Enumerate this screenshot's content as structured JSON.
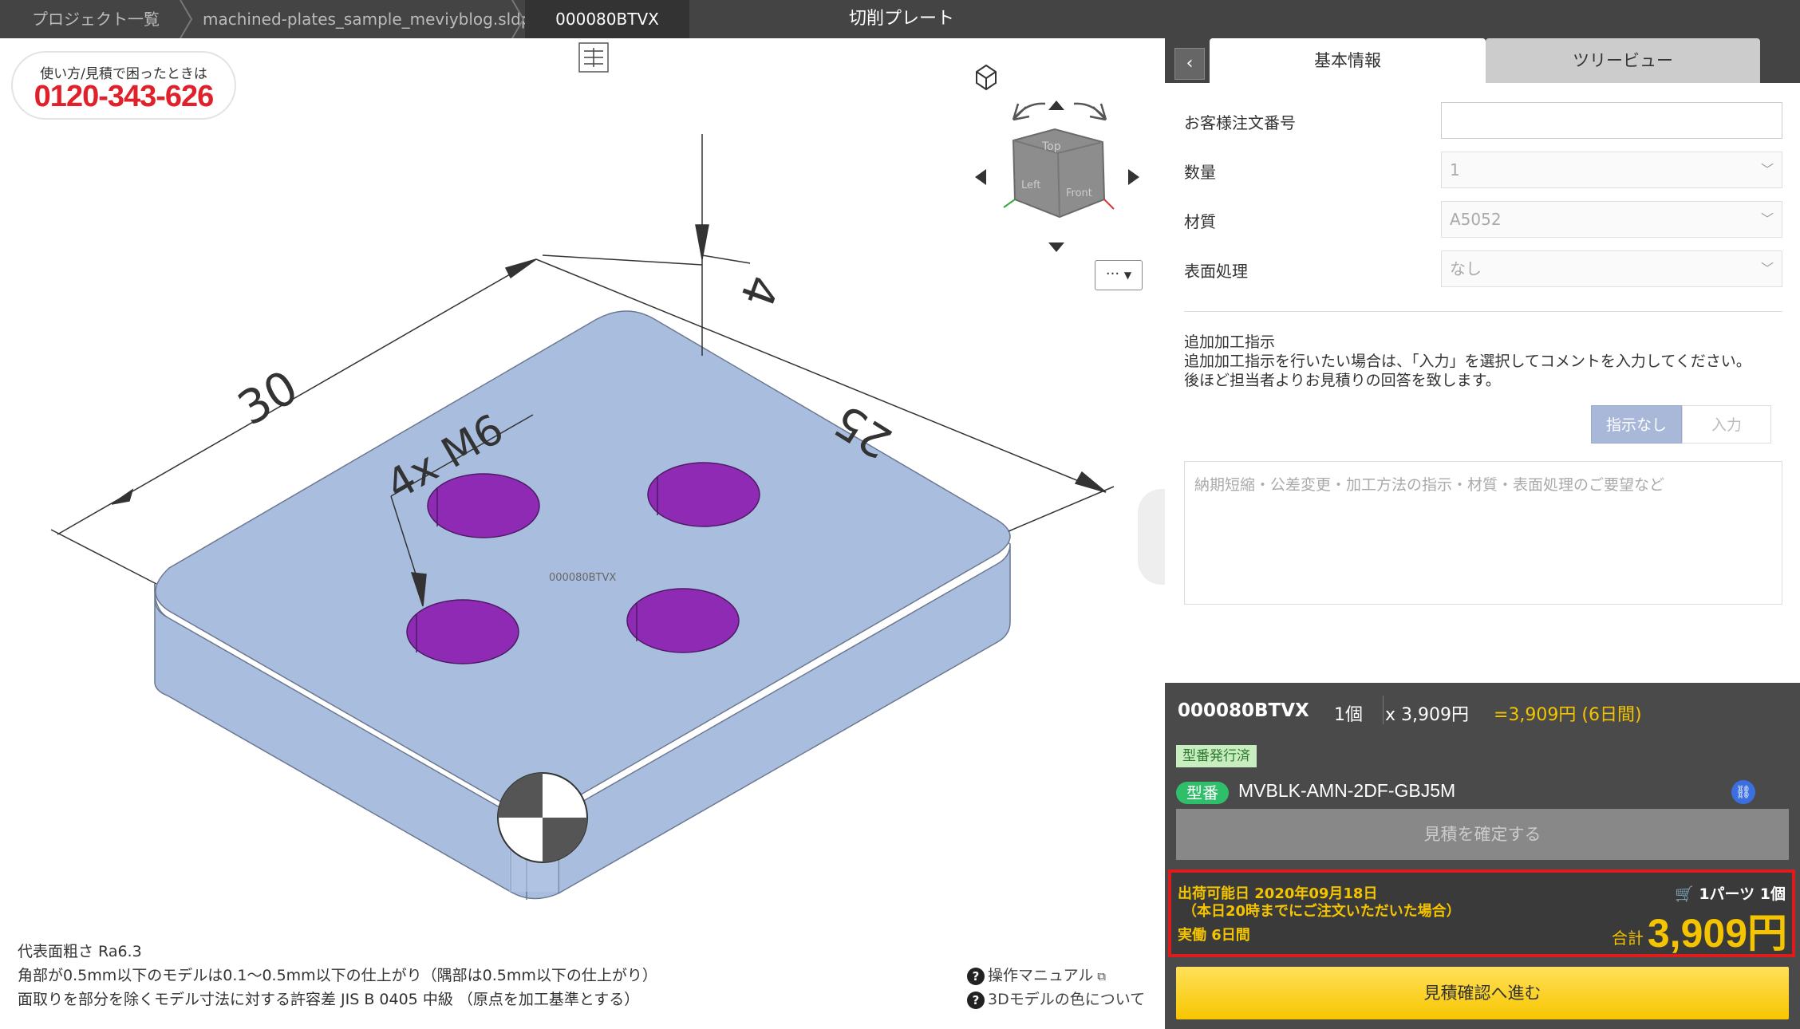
{
  "breadcrumb": {
    "items": [
      "プロジェクト一覧",
      "machined-plates_sample_meviyblog.sldprt",
      "000080BTVX"
    ]
  },
  "window_title": "切削プレート",
  "help": {
    "caption": "使い方/見積で困ったときは",
    "phone": "0120-343-626"
  },
  "view_cube_faces": [
    "Top",
    "Left",
    "Front"
  ],
  "more_menu_label": "···",
  "model": {
    "label": "000080BTVX",
    "dimensions": [
      "30",
      "25",
      "4",
      "4x M6"
    ]
  },
  "notes": [
    "代表面粗さ Ra6.3",
    "角部が0.5mm以下のモデルは0.1〜0.5mm以下の仕上がり（隅部は0.5mm以下の仕上がり）",
    "面取りを部分を除くモデル寸法に対する許容差 JIS B 0405 中級 （原点を加工基準とする）"
  ],
  "links": {
    "manual": "操作マニュアル",
    "colors": "3Dモデルの色について"
  },
  "tabs": {
    "basic": "基本情報",
    "tree": "ツリービュー"
  },
  "form": {
    "order_number_label": "お客様注文番号",
    "order_number_value": "",
    "quantity_label": "数量",
    "quantity_value": "1",
    "material_label": "材質",
    "material_value": "A5052",
    "surface_label": "表面処理",
    "surface_value": "なし"
  },
  "extra": {
    "title": "追加加工指示",
    "desc1": "追加加工指示を行いたい場合は、「入力」を選択してコメントを入力してください。",
    "desc2": "後ほど担当者よりお見積りの回答を致します。",
    "toggle_none": "指示なし",
    "toggle_input": "入力",
    "comment_placeholder": "納期短縮・公差変更・加工方法の指示・材質・表面処理のご要望など"
  },
  "summary": {
    "part": "000080BTVX",
    "qty": "1個",
    "unit_price": "x 3,909円",
    "total_line": "=3,909円 (6日間)",
    "issued_badge": "型番発行済",
    "model_badge": "型番",
    "model_number": "MVBLK-AMN-2DF-GBJ5M",
    "confirm_button": "見積を確定する",
    "ship_date": "出荷可能日 2020年09月18日",
    "ship_condition": "（本日20時までにご注文いただいた場合）",
    "workdays": "実働 6日間",
    "cart_line": "1パーツ 1個",
    "total_label": "合計",
    "total_amount": "3,909円",
    "proceed_button": "見積確認へ進む"
  },
  "colors": {
    "accent_yellow": "#f5c400",
    "alert_red": "#e01b1b",
    "plate": "#a9bedf",
    "holes": "#8f2ab5"
  }
}
